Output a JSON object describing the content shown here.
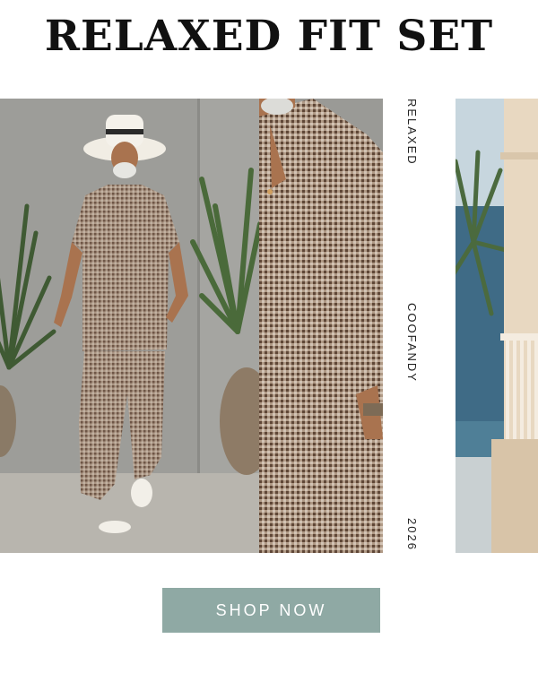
{
  "header": {
    "title": "RELAXED FIT SET"
  },
  "side_text": [
    "RELAXED",
    "COOFANDY",
    "2026"
  ],
  "cta": {
    "label": "SHOP NOW"
  },
  "colors": {
    "button": "#8fa9a4",
    "title": "#111111"
  },
  "images": [
    {
      "name": "model-full-body-photo"
    },
    {
      "name": "shirt-detail-photo"
    },
    {
      "name": "beach-balcony-photo"
    }
  ]
}
